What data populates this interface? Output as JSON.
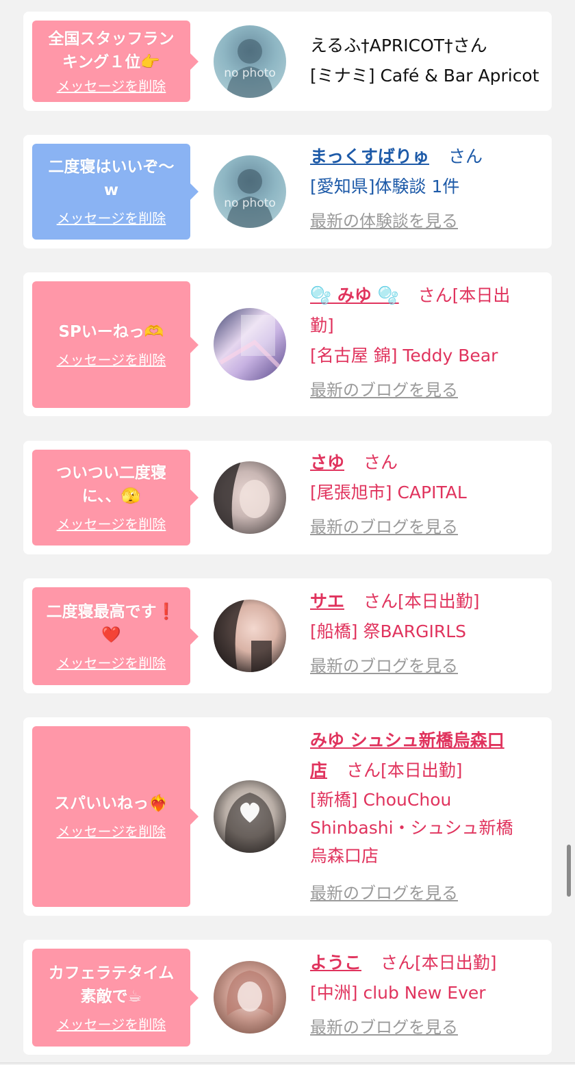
{
  "colors": {
    "pink_bubble": "#ff97a8",
    "blue_bubble": "#8ab3f3",
    "pink_text": "#e0335d",
    "blue_text": "#1d5aa8",
    "gray_link": "#9a9a9a"
  },
  "delete_label": "メッセージを削除",
  "san": "さん",
  "cards": [
    {
      "bubble_line1": "全国スタッフラン",
      "bubble_line2": "キング１位👉",
      "name_line": "えるふ†APRICOT†さん",
      "shop": "[ミナミ] Café & Bar Apricot",
      "avatar_label": "no photo"
    },
    {
      "bubble_line1": "二度寝はいいぞ〜",
      "bubble_line2": "w",
      "name": "まっくすばりゅ",
      "shop": "[愛知県]体験談 1件",
      "link": "最新の体験談を見る",
      "avatar_label": "no photo"
    },
    {
      "bubble_line1": "SPいーねっ🫶",
      "name": "🫧 みゆ 🫧",
      "suffix_line1": "[本日出",
      "suffix_line2": "勤]",
      "shop": "[名古屋 錦] Teddy Bear",
      "link": "最新のブログを見る"
    },
    {
      "bubble_line1": "ついつい二度寝",
      "bubble_line2": "に、、🫣",
      "name": "さゆ",
      "shop": "[尾張旭市] CAPITAL",
      "link": "最新のブログを見る"
    },
    {
      "bubble_line1": "二度寝最高です❗",
      "bubble_line2": "❤️",
      "name": "サエ",
      "suffix": "[本日出勤]",
      "shop": "[船橋] 祭BARGIRLS",
      "link": "最新のブログを見る"
    },
    {
      "bubble_line1": "スパいいねっ❤️‍🔥",
      "name_line1": "みゆ シュシュ新橋烏森口",
      "name_line2": "店",
      "suffix": "[本日出勤]",
      "shop_line1": "[新橋] ChouChou",
      "shop_line2": "Shinbashi・シュシュ新橋",
      "shop_line3": "烏森口店",
      "link": "最新のブログを見る"
    },
    {
      "bubble_line1": "カフェラテタイム",
      "bubble_line2": "素敵で☕",
      "name": "ようこ",
      "suffix": "[本日出勤]",
      "shop": "[中洲] club New Ever",
      "link": "最新のブログを見る"
    }
  ]
}
